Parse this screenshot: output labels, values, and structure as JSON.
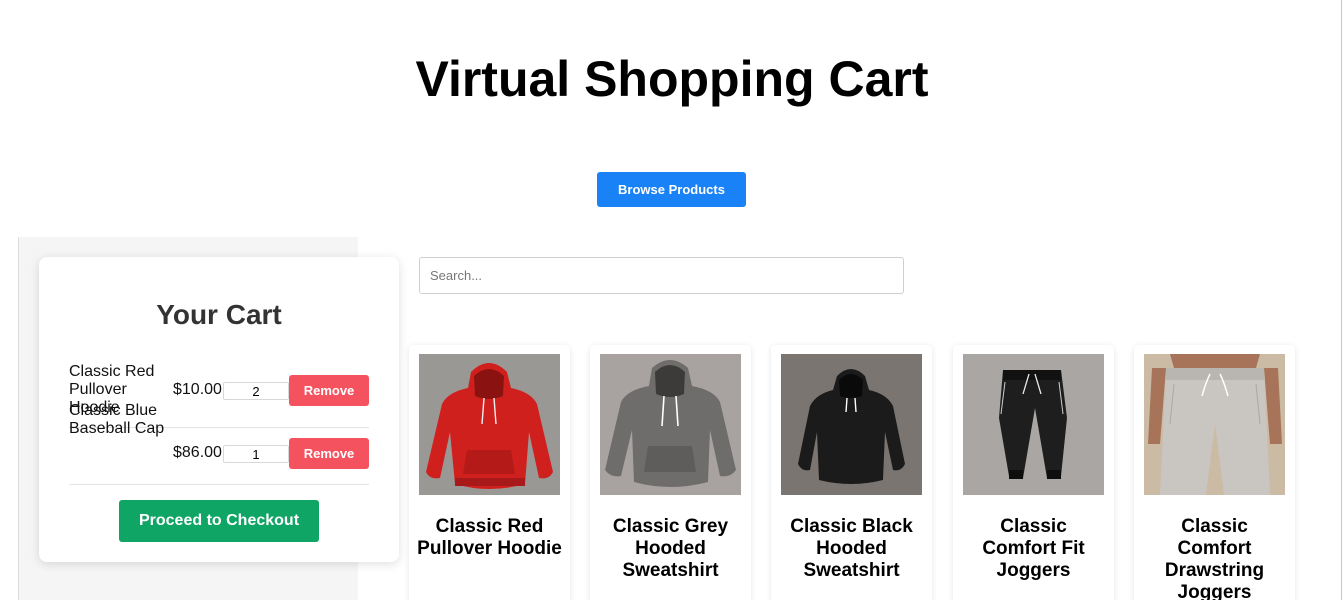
{
  "header": {
    "title": "Virtual Shopping Cart"
  },
  "toolbar": {
    "browse_label": "Browse Products"
  },
  "cart": {
    "title": "Your Cart",
    "items": [
      {
        "name": "Classic Red Pullover Hoodie",
        "price": "$10.00",
        "quantity": "2",
        "remove_label": "Remove"
      },
      {
        "name": "Classic Blue Baseball Cap",
        "price": "$86.00",
        "quantity": "1",
        "remove_label": "Remove"
      }
    ],
    "checkout_label": "Proceed to Checkout"
  },
  "search": {
    "placeholder": "Search..."
  },
  "products": [
    {
      "name": "Classic Red Pullover Hoodie",
      "image_icon": "red-hoodie-image"
    },
    {
      "name": "Classic Grey Hooded Sweatshirt",
      "image_icon": "grey-hoodie-image"
    },
    {
      "name": "Classic Black Hooded Sweatshirt",
      "image_icon": "black-hoodie-image"
    },
    {
      "name": "Classic Comfort Fit Joggers",
      "image_icon": "black-joggers-image"
    },
    {
      "name": "Classic Comfort Drawstring Joggers",
      "image_icon": "grey-joggers-image"
    }
  ],
  "colors": {
    "browse_button": "#1a82f7",
    "remove_button": "#f5525f",
    "checkout_button": "#0ea565"
  }
}
